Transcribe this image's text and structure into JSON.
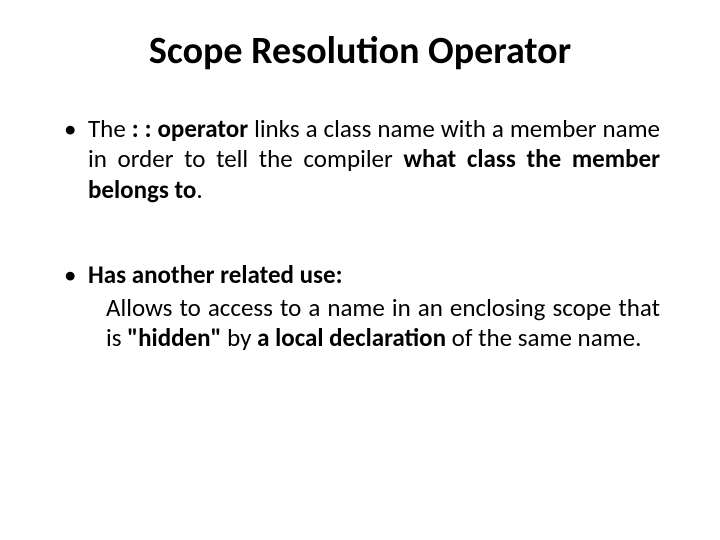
{
  "title": "Scope Resolution Operator",
  "bullet1": {
    "pre": "The ",
    "bold1": ": : operator",
    "mid": " links a class name with a member name in order to tell the compiler ",
    "bold2": "what class the member belongs to",
    "end": "."
  },
  "bullet2": {
    "lead_bold": "Has another related use:",
    "sub_pre": "Allows to access to a name in an enclosing scope that is ",
    "sub_bold1": "\"hidden\"",
    "sub_mid": " by ",
    "sub_bold2": "a local declaration",
    "sub_end": " of the same name."
  }
}
